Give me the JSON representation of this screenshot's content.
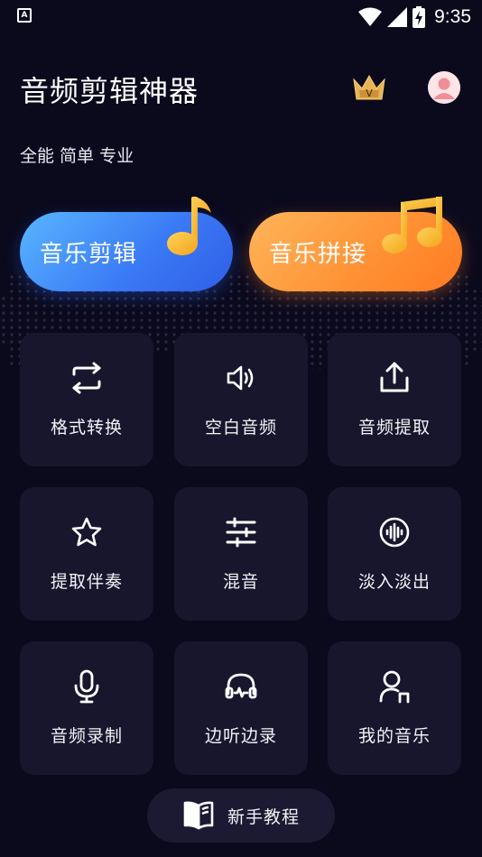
{
  "status_bar": {
    "app_icon_letter": "A",
    "time": "9:35",
    "icons": [
      "wifi-icon",
      "signal-icon",
      "battery-charging-icon"
    ]
  },
  "header": {
    "title": "音频剪辑神器",
    "tagline": "全能 简单 专业",
    "vip_badge_letter": "V"
  },
  "hero": {
    "edit_label": "音乐剪辑",
    "join_label": "音乐拼接"
  },
  "tools": [
    {
      "label": "格式转换",
      "icon": "format-convert-icon"
    },
    {
      "label": "空白音频",
      "icon": "speaker-icon"
    },
    {
      "label": "音频提取",
      "icon": "upload-icon"
    },
    {
      "label": "提取伴奏",
      "icon": "star-icon"
    },
    {
      "label": "混音",
      "icon": "sliders-icon"
    },
    {
      "label": "淡入淡出",
      "icon": "soundwave-icon"
    },
    {
      "label": "音频录制",
      "icon": "microphone-icon"
    },
    {
      "label": "边听边录",
      "icon": "headphones-icon"
    },
    {
      "label": "我的音乐",
      "icon": "user-music-icon"
    }
  ],
  "tutorial": {
    "label": "新手教程",
    "icon": "book-icon"
  },
  "colors": {
    "background": "#0b0a1d",
    "tile": "#17162d",
    "hero_edit": "#3a78f5",
    "hero_join": "#ff9033",
    "note_gold": "#ffc23a"
  }
}
